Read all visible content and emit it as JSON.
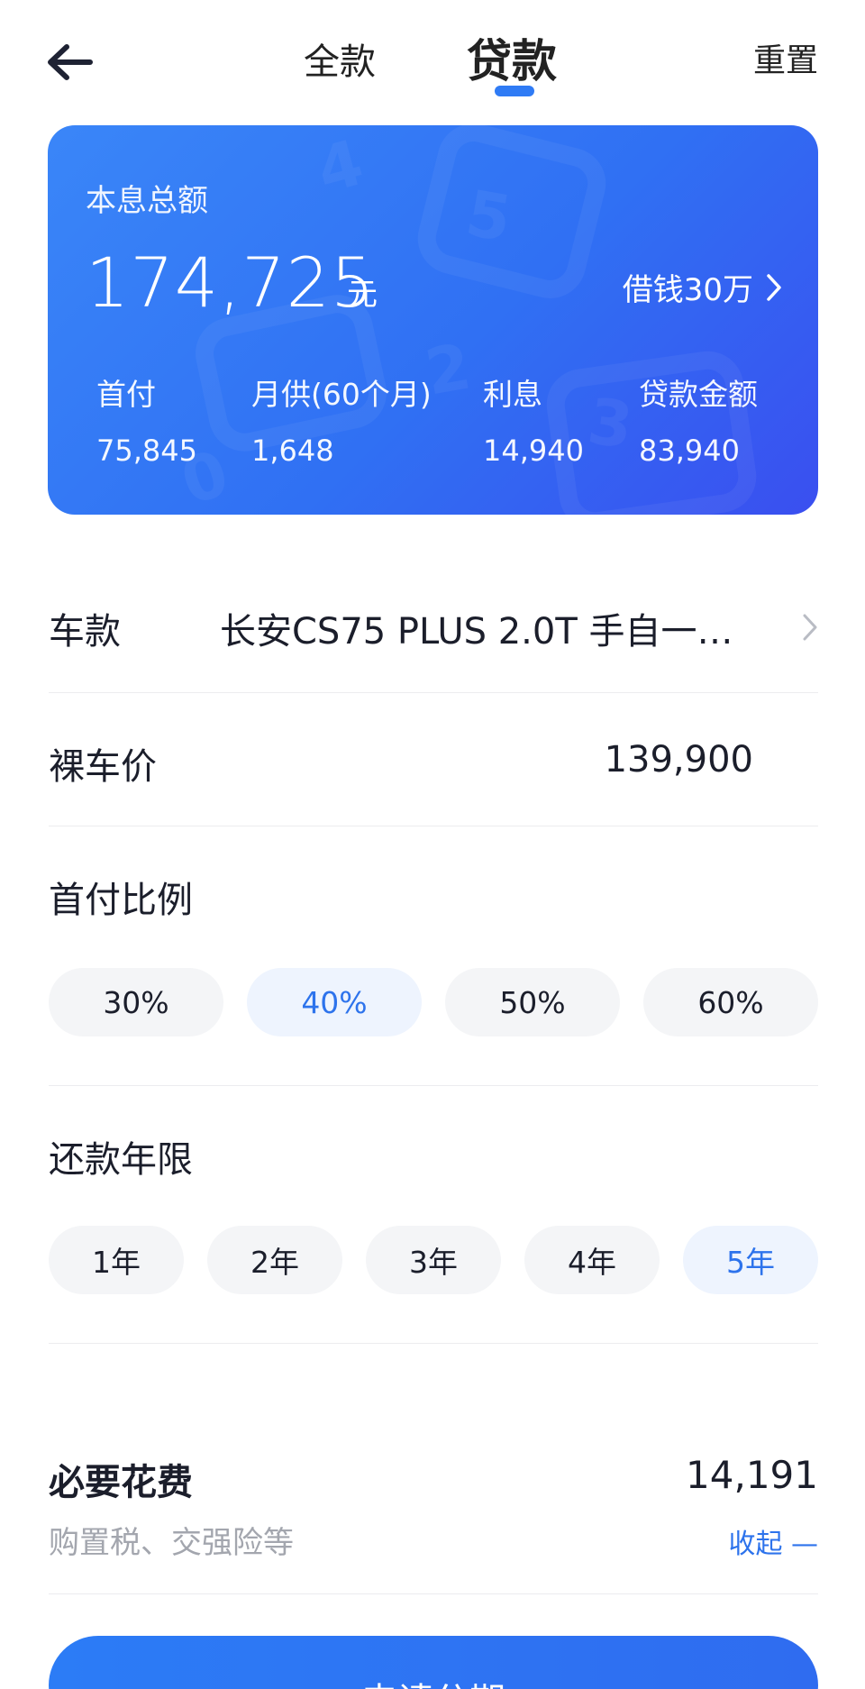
{
  "header": {
    "back_icon": "arrow-left-icon",
    "tab_full": "全款",
    "tab_loan": "贷款",
    "reset": "重置"
  },
  "summary": {
    "title": "本息总额",
    "total": "174,725",
    "unit": "元",
    "borrow_link": "借钱30万",
    "stats": [
      {
        "label": "首付",
        "value": "75,845"
      },
      {
        "label": "月供(60个月)",
        "value": "1,648"
      },
      {
        "label": "利息",
        "value": "14,940"
      },
      {
        "label": "贷款金额",
        "value": "83,940"
      }
    ]
  },
  "model": {
    "label": "车款",
    "value": "长安CS75 PLUS 2.0T 手自一…"
  },
  "price": {
    "label": "裸车价",
    "value": "139,900"
  },
  "down_payment": {
    "title": "首付比例",
    "options": [
      "30%",
      "40%",
      "50%",
      "60%"
    ],
    "selected": "40%"
  },
  "term": {
    "title": "还款年限",
    "options": [
      "1年",
      "2年",
      "3年",
      "4年",
      "5年"
    ],
    "selected": "5年"
  },
  "fees": {
    "title": "必要花费",
    "subtitle": "购置税、交强险等",
    "amount": "14,191",
    "collapse": "收起 —"
  },
  "apply_button": "申请分期",
  "colors": {
    "accent": "#2f7bf5",
    "card_gradient_start": "#3a86f8",
    "card_gradient_end": "#3a4ff0",
    "pill_active_bg": "#eef4fe",
    "pill_active_text": "#2d73ec"
  }
}
